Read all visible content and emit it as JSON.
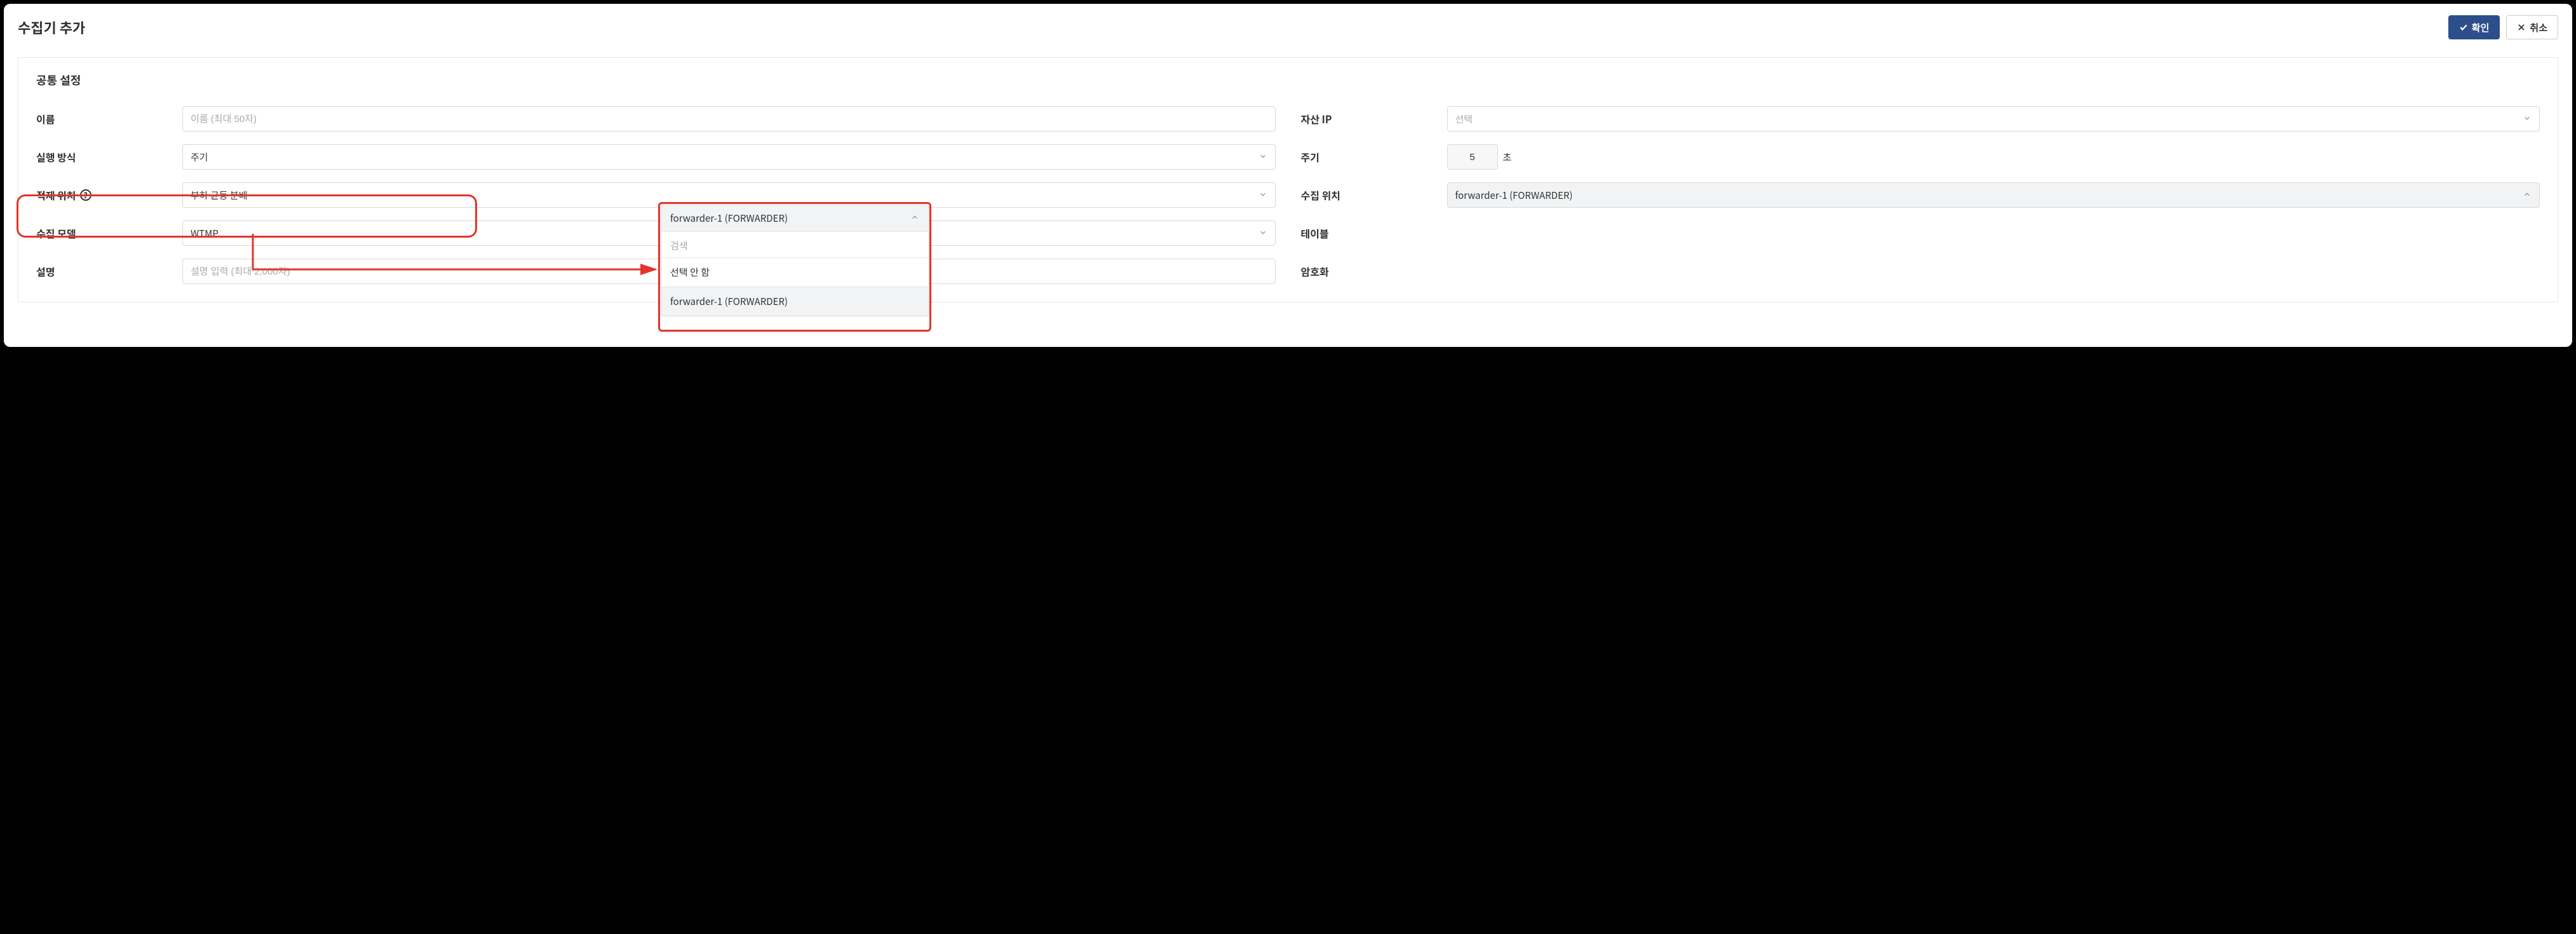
{
  "header": {
    "title": "수집기 추가",
    "confirm_label": "확인",
    "cancel_label": "취소"
  },
  "panel": {
    "title": "공통 설정"
  },
  "fields": {
    "name": {
      "label": "이름",
      "placeholder": "이름 (최대 50자)",
      "value": ""
    },
    "asset_ip": {
      "label": "자산 IP",
      "placeholder": "선택",
      "value": ""
    },
    "exec_mode": {
      "label": "실행 방식",
      "value": "주기"
    },
    "period": {
      "label": "주기",
      "value": "5",
      "unit": "초"
    },
    "load_location": {
      "label": "적재 위치",
      "value": "부하 균등 분배"
    },
    "collect_location": {
      "label": "수집 위치",
      "value": "forwarder-1 (FORWARDER)"
    },
    "collect_model": {
      "label": "수집 모델",
      "value": "WTMP"
    },
    "table": {
      "label": "테이블"
    },
    "description": {
      "label": "설명",
      "placeholder": "설명 입력 (최대 2,000자)",
      "value": ""
    },
    "encryption": {
      "label": "암호화"
    }
  },
  "dropdown": {
    "selected": "forwarder-1 (FORWARDER)",
    "search_placeholder": "검색",
    "options": [
      "선택 안 함",
      "forwarder-1 (FORWARDER)"
    ]
  }
}
